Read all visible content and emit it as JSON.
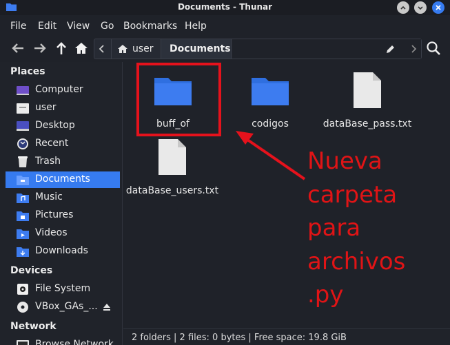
{
  "window": {
    "title": "Documents - Thunar"
  },
  "menubar": {
    "items": [
      "File",
      "Edit",
      "View",
      "Go",
      "Bookmarks",
      "Help"
    ]
  },
  "pathbar": {
    "segments": [
      "user",
      "Documents"
    ]
  },
  "sidebar": {
    "places_title": "Places",
    "places": [
      {
        "label": "Computer",
        "icon": "computer-icon"
      },
      {
        "label": "user",
        "icon": "home-folder-icon"
      },
      {
        "label": "Desktop",
        "icon": "desktop-icon"
      },
      {
        "label": "Recent",
        "icon": "recent-icon"
      },
      {
        "label": "Trash",
        "icon": "trash-icon"
      },
      {
        "label": "Documents",
        "icon": "documents-folder-icon",
        "active": true
      },
      {
        "label": "Music",
        "icon": "music-folder-icon"
      },
      {
        "label": "Pictures",
        "icon": "pictures-folder-icon"
      },
      {
        "label": "Videos",
        "icon": "videos-folder-icon"
      },
      {
        "label": "Downloads",
        "icon": "downloads-folder-icon"
      }
    ],
    "devices_title": "Devices",
    "devices": [
      {
        "label": "File System",
        "icon": "drive-icon"
      },
      {
        "label": "VBox_GAs_...",
        "icon": "optical-disc-icon"
      }
    ],
    "network_title": "Network",
    "network": [
      {
        "label": "Browse Network",
        "icon": "network-icon"
      }
    ]
  },
  "files": [
    {
      "name": "buff_of",
      "type": "folder"
    },
    {
      "name": "codigos",
      "type": "folder"
    },
    {
      "name": "dataBase_pass.txt",
      "type": "text"
    },
    {
      "name": "dataBase_users.txt",
      "type": "text"
    }
  ],
  "annotation": {
    "lines": [
      "Nueva",
      "carpeta",
      "para",
      "archivos",
      ".py"
    ],
    "color": "#e01416"
  },
  "status": {
    "text": "2 folders | 2 files: 0 bytes | Free space: 19.8 GiB"
  },
  "colors": {
    "accent": "#367bf0",
    "folder": "#3d7cf0",
    "background": "#1f2229"
  }
}
